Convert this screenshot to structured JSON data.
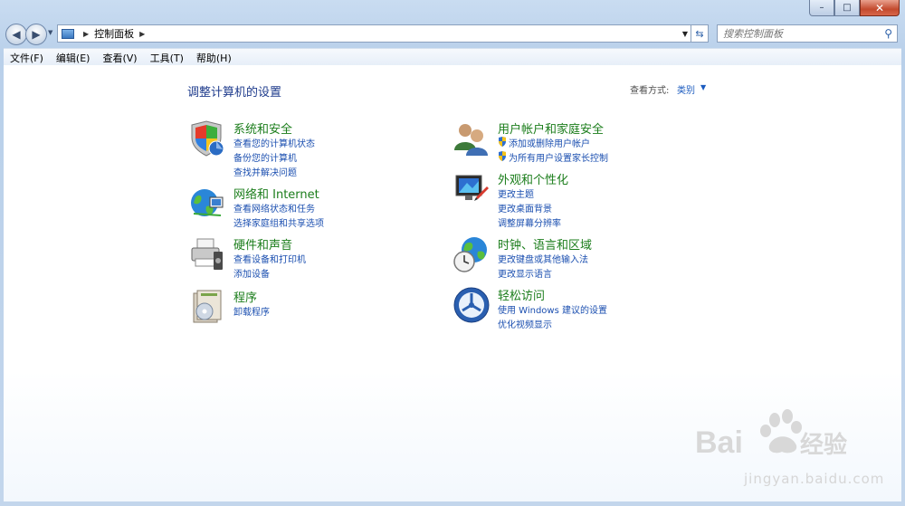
{
  "window": {
    "caption": {
      "minimize": "–",
      "maximize": "□",
      "close": "✕"
    }
  },
  "nav": {
    "back_icon": "◀",
    "forward_icon": "▶",
    "breadcrumb": "控制面板",
    "search_placeholder": "搜索控制面板"
  },
  "menu": [
    "文件(F)",
    "编辑(E)",
    "查看(V)",
    "工具(T)",
    "帮助(H)"
  ],
  "header": {
    "title": "调整计算机的设置",
    "view_by_label": "查看方式:",
    "view_by_value": "类别"
  },
  "categories": {
    "system": {
      "title": "系统和安全",
      "links": [
        "查看您的计算机状态",
        "备份您的计算机",
        "查找并解决问题"
      ]
    },
    "network": {
      "title": "网络和 Internet",
      "links": [
        "查看网络状态和任务",
        "选择家庭组和共享选项"
      ]
    },
    "hardware": {
      "title": "硬件和声音",
      "links": [
        "查看设备和打印机",
        "添加设备"
      ]
    },
    "programs": {
      "title": "程序",
      "links": [
        "卸载程序"
      ]
    },
    "users": {
      "title": "用户帐户和家庭安全",
      "links": [
        "添加或删除用户帐户",
        "为所有用户设置家长控制"
      ]
    },
    "appearance": {
      "title": "外观和个性化",
      "links": [
        "更改主题",
        "更改桌面背景",
        "调整屏幕分辨率"
      ]
    },
    "clock": {
      "title": "时钟、语言和区域",
      "links": [
        "更改键盘或其他输入法",
        "更改显示语言"
      ]
    },
    "ease": {
      "title": "轻松访问",
      "links": [
        "使用 Windows 建议的设置",
        "优化视频显示"
      ]
    }
  },
  "watermark": {
    "text": "jingyan.baidu.com"
  },
  "colors": {
    "category_title": "#1b7d1b",
    "link": "#1b4fb0",
    "page_title": "#1e3b8c"
  }
}
